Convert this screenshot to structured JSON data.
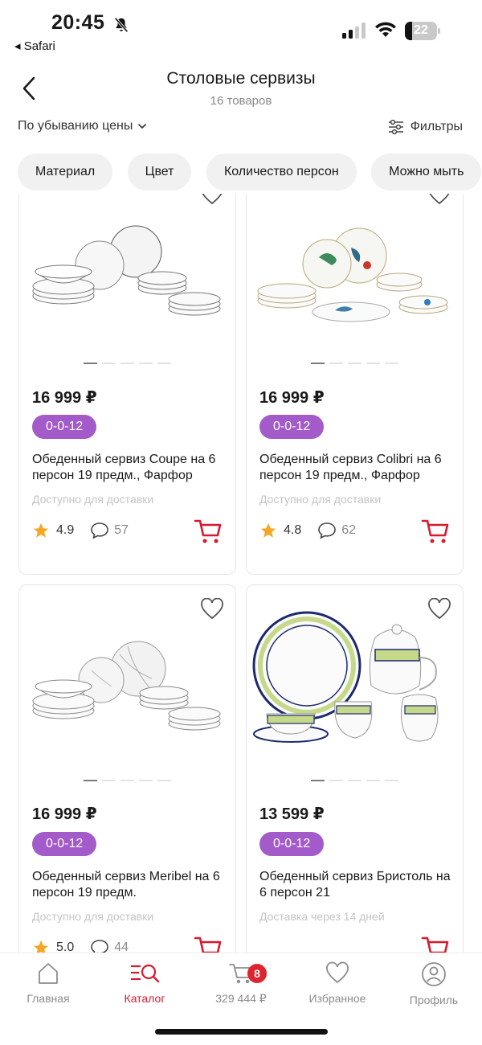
{
  "status_bar": {
    "time": "20:45",
    "back_app": "◂ Safari",
    "battery": "22"
  },
  "header": {
    "title": "Столовые сервизы",
    "subtitle": "16 товаров"
  },
  "sort": {
    "label": "По убыванию цены"
  },
  "filter": {
    "label": "Фильтры"
  },
  "chips": [
    "Материал",
    "Цвет",
    "Количество персон",
    "Можно мыть"
  ],
  "products": [
    {
      "price": "16 999 ₽",
      "installment": "0-0-12",
      "name": "Обеденный сервиз Coupe на 6 персон 19 предм., Фарфор",
      "availability": "Доступно для доставки",
      "rating": "4.9",
      "reviews": "57"
    },
    {
      "price": "16 999 ₽",
      "installment": "0-0-12",
      "name": "Обеденный сервиз Colibri на 6 персон 19 предм., Фарфор",
      "availability": "Доступно для доставки",
      "rating": "4.8",
      "reviews": "62"
    },
    {
      "price": "16 999 ₽",
      "installment": "0-0-12",
      "name": "Обеденный сервиз Meribel на 6 персон 19 предм.",
      "availability": "Доступно для доставки",
      "rating": "5.0",
      "reviews": "44"
    },
    {
      "price": "13 599 ₽",
      "installment": "0-0-12",
      "name": "Обеденный сервиз Бристоль на 6 персон 21",
      "availability": "Доставка через 14 дней",
      "rating": "",
      "reviews": ""
    }
  ],
  "tabbar": {
    "home": "Главная",
    "catalog": "Каталог",
    "cart": "329 444 ₽",
    "cart_count": "8",
    "favorites": "Избранное",
    "profile": "Профиль"
  },
  "colors": {
    "accent": "#d71a2f",
    "badge": "#a35bc9",
    "star": "#f5a623"
  }
}
